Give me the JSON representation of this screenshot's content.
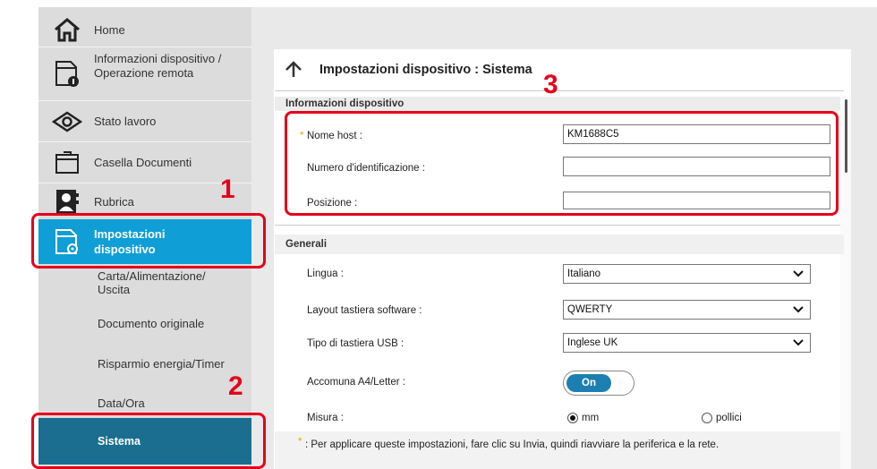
{
  "sidebar": {
    "home": "Home",
    "device_info": "Informazioni dispositivo / Operazione remota",
    "job_status": "Stato lavoro",
    "document_box": "Casella Documenti",
    "address_book": "Rubrica",
    "device_settings": "Impostazioni dispositivo",
    "sub": {
      "paper": "Carta/Alimentazione/ Uscita",
      "original": "Documento originale",
      "energy": "Risparmio energia/Timer",
      "datetime": "Data/Ora",
      "system": "Sistema"
    }
  },
  "page": {
    "title": "Impostazioni dispositivo : Sistema"
  },
  "device_info_section": {
    "heading": "Informazioni dispositivo",
    "required_mark": "*",
    "host_label": "Nome host :",
    "host_value": "KM1688C5",
    "id_label": "Numero d'identificazione :",
    "id_value": "",
    "location_label": "Posizione :",
    "location_value": ""
  },
  "general_section": {
    "heading": "Generali",
    "language_label": "Lingua :",
    "language_value": "Italiano",
    "keyboard_label": "Layout tastiera software :",
    "keyboard_value": "QWERTY",
    "usb_label": "Tipo di tastiera USB :",
    "usb_value": "Inglese UK",
    "a4_label": "Accomuna A4/Letter :",
    "a4_value": "On",
    "measure_label": "Misura :",
    "measure_opt1": "mm",
    "measure_opt2": "pollici"
  },
  "footer_note": {
    "mark": "*",
    "text": ": Per applicare queste impostazioni, fare clic su Invia, quindi riavviare la periferica e la rete."
  },
  "annotations": {
    "one": "1",
    "two": "2",
    "three": "3"
  },
  "colors": {
    "nav_active": "#0f9ed5",
    "nav_system": "#1b6e8f",
    "annotation_red": "#e4001b",
    "toggle": "#1d7fb0"
  }
}
